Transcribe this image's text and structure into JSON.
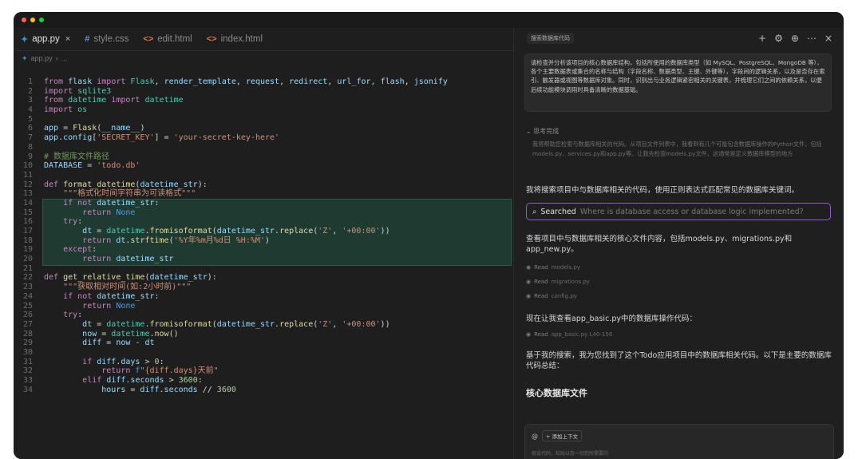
{
  "window": {
    "controls": [
      "close",
      "minimize",
      "maximize"
    ]
  },
  "editor": {
    "tabs": [
      {
        "label": "app.py",
        "icon": "python-icon",
        "active": true,
        "closable": true
      },
      {
        "label": "style.css",
        "icon": "hash-icon",
        "active": false
      },
      {
        "label": "edit.html",
        "icon": "code-icon",
        "active": false
      },
      {
        "label": "index.html",
        "icon": "code-icon",
        "active": false
      }
    ],
    "breadcrumb": {
      "file": "app.py",
      "more": "..."
    },
    "lines": [
      {
        "n": "1",
        "t": "from flask import Flask, render_template, request, redirect, url_for, flash, jsonify"
      },
      {
        "n": "2",
        "t": "import sqlite3"
      },
      {
        "n": "3",
        "t": "from datetime import datetime"
      },
      {
        "n": "4",
        "t": "import os"
      },
      {
        "n": "5",
        "t": ""
      },
      {
        "n": "6",
        "t": "app = Flask(__name__)"
      },
      {
        "n": "7",
        "t": "app.config['SECRET_KEY'] = 'your-secret-key-here'"
      },
      {
        "n": "8",
        "t": ""
      },
      {
        "n": "9",
        "t": "# 数据库文件路径"
      },
      {
        "n": "10",
        "t": "DATABASE = 'todo.db'"
      },
      {
        "n": "11",
        "t": ""
      },
      {
        "n": "12",
        "t": "def format_datetime(datetime_str):"
      },
      {
        "n": "13",
        "t": "    \"\"\"格式化时间字符串为可读格式\"\"\""
      },
      {
        "n": "14",
        "t": "    if not datetime_str:"
      },
      {
        "n": "15",
        "t": "        return None"
      },
      {
        "n": "16",
        "t": "    try:"
      },
      {
        "n": "17",
        "t": "        dt = datetime.fromisoformat(datetime_str.replace('Z', '+00:00'))"
      },
      {
        "n": "18",
        "t": "        return dt.strftime('%Y年%m月%d日 %H:%M')"
      },
      {
        "n": "19",
        "t": "    except:"
      },
      {
        "n": "20",
        "t": "        return datetime_str"
      },
      {
        "n": "21",
        "t": ""
      },
      {
        "n": "22",
        "t": "def get_relative_time(datetime_str):"
      },
      {
        "n": "23",
        "t": "    \"\"\"获取相对时间(如:2小时前)\"\"\""
      },
      {
        "n": "24",
        "t": "    if not datetime_str:"
      },
      {
        "n": "25",
        "t": "        return None"
      },
      {
        "n": "26",
        "t": "    try:"
      },
      {
        "n": "27",
        "t": "        dt = datetime.fromisoformat(datetime_str.replace('Z', '+00:00'))"
      },
      {
        "n": "28",
        "t": "        now = datetime.now()"
      },
      {
        "n": "29",
        "t": "        diff = now - dt"
      },
      {
        "n": "30",
        "t": ""
      },
      {
        "n": "31",
        "t": "        if diff.days > 0:"
      },
      {
        "n": "32",
        "t": "            return f\"{diff.days}天前\""
      },
      {
        "n": "33",
        "t": "        elif diff.seconds > 3600:"
      },
      {
        "n": "34",
        "t": "            hours = diff.seconds // 3600"
      }
    ],
    "highlight_from_line": 14,
    "highlight_to_line": 20
  },
  "chat": {
    "title": "搜索数据库代码",
    "actions": [
      "plus-icon",
      "gear-icon",
      "globe-icon",
      "more-icon",
      "close-icon"
    ],
    "user_prompt": "请检查并分析该项目的核心数据库结构，包括所使用的数据库类型（如 MySQL、PostgreSQL、MongoDB 等），各个主要数据表或集合的名称与结构（字段名称、数据类型、主键、外键等），字段间的逻辑关系，以及是否存在索引、触发器或视图等数据库对象。同时，识别出与业务逻辑紧密相关的关键表，并梳理它们之间的依赖关系，以便后续功能模块调用时具备清晰的数据基础。",
    "thinking_label": "思考完成",
    "thinking_text": "我将帮助您检索与数据库相关的代码。从项目文件列表中，我看到有几个可能包含数据库操作的Python文件，包括models.py、services.py和app.py等。让我先检查models.py文件，这通常是定义数据库模型的地方",
    "msg1": "我将搜索项目中与数据库相关的代码，使用正则表达式匹配常见的数据库关键词。",
    "search": {
      "label": "Searched",
      "query": "Where is database access or database logic implemented?"
    },
    "msg2": "查看项目中与数据库相关的核心文件内容，包括models.py、migrations.py和app_new.py。",
    "reads": [
      {
        "label": "Read",
        "file": "models.py"
      },
      {
        "label": "Read",
        "file": "migrations.py"
      },
      {
        "label": "Read",
        "file": "config.py"
      }
    ],
    "msg3": "现在让我查看app_basic.py中的数据库操作代码：",
    "read4": {
      "label": "Read",
      "file": "app_basic.py L40-156"
    },
    "msg4": "基于我的搜索，我为您找到了这个Todo应用项目中的数据库相关代码。以下是主要的数据库代码总结：",
    "heading": "核心数据库文件",
    "composer": {
      "add_context": "添加上下文",
      "placeholder": "假设代码，粘贴以及一切您所需要的"
    }
  }
}
